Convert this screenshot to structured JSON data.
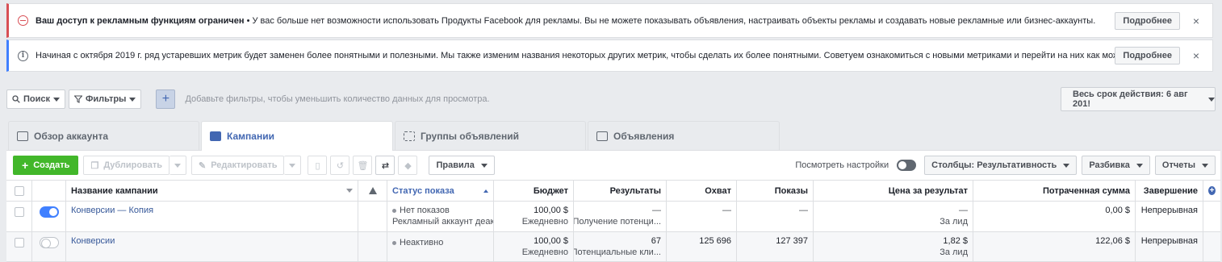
{
  "banners": [
    {
      "title": "Ваш доступ к рекламным функциям ограничен",
      "text": " • У вас больше нет возможности использовать Продукты Facebook для рекламы. Вы не можете показывать объявления, настраивать объекты рекламы и создавать новые рекламные или бизнес-аккаунты.",
      "button": "Подробнее"
    },
    {
      "title": "",
      "text": "Начиная с октября 2019 г. ряд устаревших метрик будет заменен более понятными и полезными. Мы также изменим названия некоторых других метрик, чтобы сделать их более понятными. Советуем ознакомиться с новыми метриками и перейти на них как можно скорее.",
      "button": "Подробнее"
    }
  ],
  "filters": {
    "search_label": "Поиск",
    "filters_label": "Фильтры",
    "hint": "Добавьте фильтры, чтобы уменьшить количество данных для просмотра.",
    "date_range": "Весь срок действия: 6 авг 201!"
  },
  "tabs": [
    {
      "label": "Обзор аккаунта",
      "icon": "account-overview-icon"
    },
    {
      "label": "Кампании",
      "icon": "folder-icon"
    },
    {
      "label": "Группы объявлений",
      "icon": "grid-icon"
    },
    {
      "label": "Объявления",
      "icon": "ad-icon"
    }
  ],
  "toolbar": {
    "create": "Создать",
    "duplicate": "Дублировать",
    "edit": "Редактировать",
    "rules": "Правила",
    "view_settings": "Посмотреть настройки",
    "columns": "Столбцы: Результативность",
    "breakdown": "Разбивка",
    "reports": "Отчеты"
  },
  "table": {
    "headers": {
      "name": "Название кампании",
      "status": "Статус показа",
      "budget": "Бюджет",
      "results": "Результаты",
      "reach": "Охват",
      "impressions": "Показы",
      "cpr": "Цена за результат",
      "spend": "Потраченная сумма",
      "end": "Завершение"
    },
    "rows": [
      {
        "name": "Конверсии — Копия",
        "status": "Нет показов",
        "status_sub": "Рекламный аккаунт деакти",
        "budget": "100,00 $",
        "budget_sub": "Ежедневно",
        "results": "—",
        "results_sub": "Получение потенци...",
        "reach": "—",
        "impressions": "—",
        "cpr": "—",
        "cpr_sub": "За лид",
        "spend": "0,00 $",
        "end": "Непрерывная",
        "active": true
      },
      {
        "name": "Конверсии",
        "status": "Неактивно",
        "status_sub": "",
        "budget": "100,00 $",
        "budget_sub": "Ежедневно",
        "results": "67",
        "results_sub": "Потенциальные кли...",
        "reach": "125 696",
        "impressions": "127 397",
        "cpr": "1,82 $",
        "cpr_sub": "За лид",
        "spend": "122,06 $",
        "end": "Непрерывная",
        "active": false
      }
    ]
  }
}
